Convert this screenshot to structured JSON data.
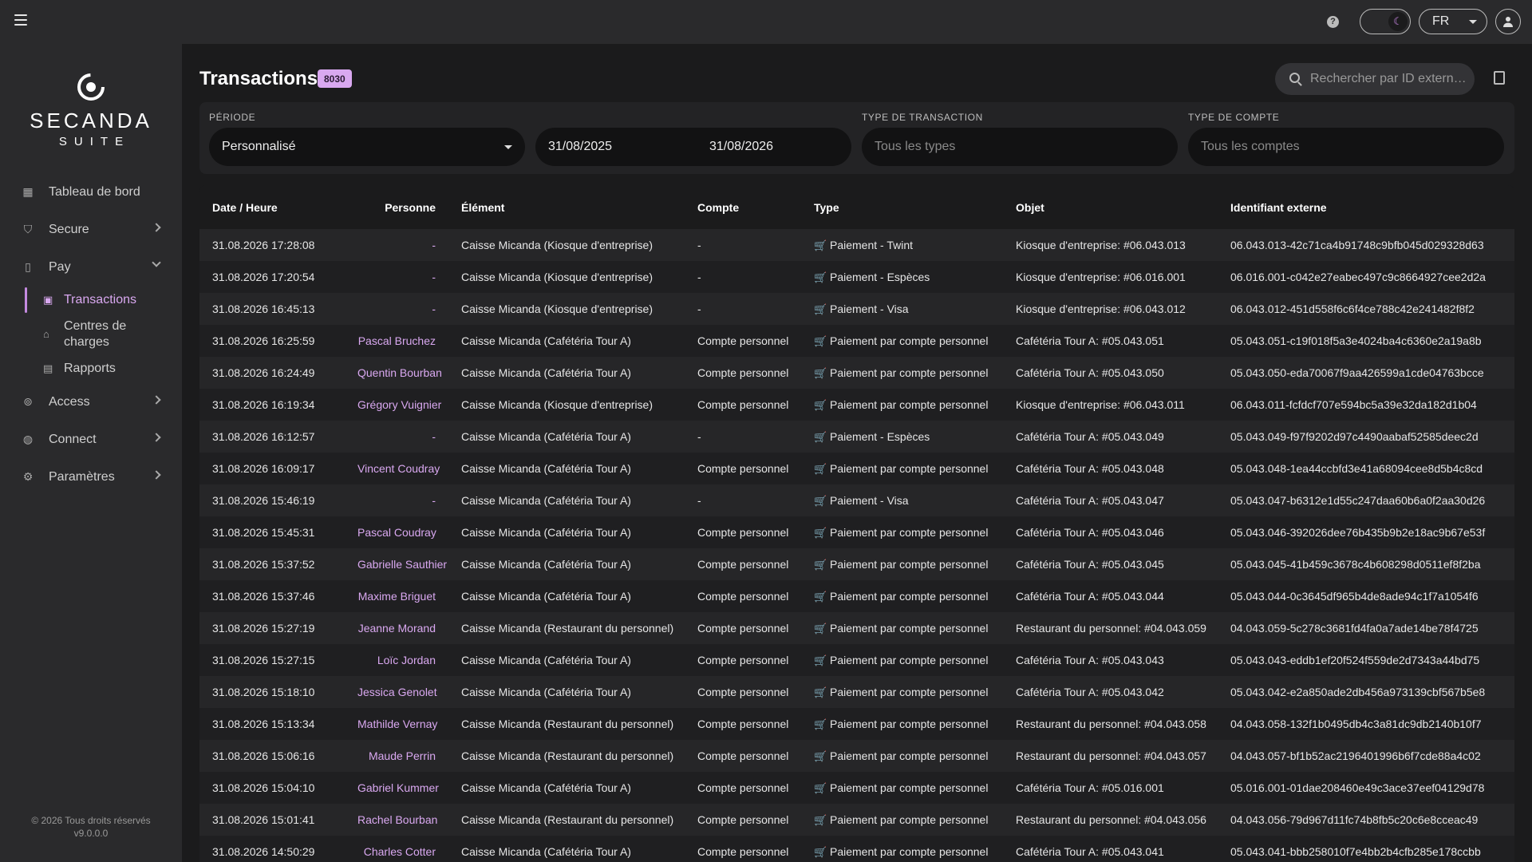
{
  "topbar": {
    "language": "FR"
  },
  "sidebar": {
    "logo_name": "SECANDA",
    "logo_sub": "SUITE",
    "items": [
      {
        "label": "Tableau de bord",
        "icon": "grid-icon"
      },
      {
        "label": "Secure",
        "icon": "shield-icon"
      },
      {
        "label": "Pay",
        "icon": "phone-icon"
      },
      {
        "label": "Access",
        "icon": "lock-icon"
      },
      {
        "label": "Connect",
        "icon": "globe-icon"
      },
      {
        "label": "Paramètres",
        "icon": "gear-icon"
      }
    ],
    "pay_sub": [
      {
        "label": "Transactions",
        "icon": "money-icon"
      },
      {
        "label": "Centres de charges",
        "icon": "bank-icon"
      },
      {
        "label": "Rapports",
        "icon": "document-icon"
      }
    ],
    "footer_copyright": "© 2026 Tous droits réservés",
    "footer_version": "v9.0.0.0"
  },
  "page": {
    "title": "Transactions",
    "count": "8030",
    "search_placeholder": "Rechercher par ID extern…"
  },
  "filters": {
    "periode_label": "PÉRIODE",
    "periode_value": "Personnalisé",
    "date_from": "31/08/2025",
    "date_to": "31/08/2026",
    "type_label": "TYPE DE TRANSACTION",
    "type_placeholder": "Tous les types",
    "compte_label": "TYPE DE COMPTE",
    "compte_placeholder": "Tous les comptes"
  },
  "table": {
    "headers": [
      "Date / Heure",
      "Personne",
      "Élément",
      "Compte",
      "Type",
      "Objet",
      "Identifiant externe"
    ],
    "rows": [
      [
        "31.08.2026 17:28:08",
        "-",
        "Caisse Micanda (Kiosque d'entreprise)",
        "-",
        "Paiement - Twint",
        "Kiosque d'entreprise: #06.043.013",
        "06.043.013-42c71ca4b91748c9bfb045d029328d63"
      ],
      [
        "31.08.2026 17:20:54",
        "-",
        "Caisse Micanda (Kiosque d'entreprise)",
        "-",
        "Paiement - Espèces",
        "Kiosque d'entreprise: #06.016.001",
        "06.016.001-c042e27eabec497c9c8664927cee2d2a"
      ],
      [
        "31.08.2026 16:45:13",
        "-",
        "Caisse Micanda (Kiosque d'entreprise)",
        "-",
        "Paiement - Visa",
        "Kiosque d'entreprise: #06.043.012",
        "06.043.012-451d558f6c6f4ce788c42e241482f8f2"
      ],
      [
        "31.08.2026 16:25:59",
        "Pascal Bruchez",
        "Caisse Micanda (Cafétéria Tour A)",
        "Compte personnel",
        "Paiement par compte personnel",
        "Cafétéria Tour A: #05.043.051",
        "05.043.051-c19f018f5a3e4024ba4c6360e2a19a8b"
      ],
      [
        "31.08.2026 16:24:49",
        "Quentin Bourban",
        "Caisse Micanda (Cafétéria Tour A)",
        "Compte personnel",
        "Paiement par compte personnel",
        "Cafétéria Tour A: #05.043.050",
        "05.043.050-eda70067f9aa426599a1cde04763bcce"
      ],
      [
        "31.08.2026 16:19:34",
        "Grégory Vuignier",
        "Caisse Micanda (Kiosque d'entreprise)",
        "Compte personnel",
        "Paiement par compte personnel",
        "Kiosque d'entreprise: #06.043.011",
        "06.043.011-fcfdcf707e594bc5a39e32da182d1b04"
      ],
      [
        "31.08.2026 16:12:57",
        "-",
        "Caisse Micanda (Cafétéria Tour A)",
        "-",
        "Paiement - Espèces",
        "Cafétéria Tour A: #05.043.049",
        "05.043.049-f97f9202d97c4490aabaf52585deec2d"
      ],
      [
        "31.08.2026 16:09:17",
        "Vincent Coudray",
        "Caisse Micanda (Cafétéria Tour A)",
        "Compte personnel",
        "Paiement par compte personnel",
        "Cafétéria Tour A: #05.043.048",
        "05.043.048-1ea44ccbfd3e41a68094cee8d5b4c8cd"
      ],
      [
        "31.08.2026 15:46:19",
        "-",
        "Caisse Micanda (Cafétéria Tour A)",
        "-",
        "Paiement - Visa",
        "Cafétéria Tour A: #05.043.047",
        "05.043.047-b6312e1d55c247daa60b6a0f2aa30d26"
      ],
      [
        "31.08.2026 15:45:31",
        "Pascal Coudray",
        "Caisse Micanda (Cafétéria Tour A)",
        "Compte personnel",
        "Paiement par compte personnel",
        "Cafétéria Tour A: #05.043.046",
        "05.043.046-392026dee76b435b9b2e18ac9b67e53f"
      ],
      [
        "31.08.2026 15:37:52",
        "Gabrielle Sauthier",
        "Caisse Micanda (Cafétéria Tour A)",
        "Compte personnel",
        "Paiement par compte personnel",
        "Cafétéria Tour A: #05.043.045",
        "05.043.045-41b459c3678c4b608298d0511ef8f2ba"
      ],
      [
        "31.08.2026 15:37:46",
        "Maxime Briguet",
        "Caisse Micanda (Cafétéria Tour A)",
        "Compte personnel",
        "Paiement par compte personnel",
        "Cafétéria Tour A: #05.043.044",
        "05.043.044-0c3645df965b4de8ade94c1f7a1054f6"
      ],
      [
        "31.08.2026 15:27:19",
        "Jeanne Morand",
        "Caisse Micanda (Restaurant du personnel)",
        "Compte personnel",
        "Paiement par compte personnel",
        "Restaurant du personnel: #04.043.059",
        "04.043.059-5c278c3681fd4fa0a7ade14be78f4725"
      ],
      [
        "31.08.2026 15:27:15",
        "Loïc Jordan",
        "Caisse Micanda (Cafétéria Tour A)",
        "Compte personnel",
        "Paiement par compte personnel",
        "Cafétéria Tour A: #05.043.043",
        "05.043.043-eddb1ef20f524f559de2d7343a44bd75"
      ],
      [
        "31.08.2026 15:18:10",
        "Jessica Genolet",
        "Caisse Micanda (Cafétéria Tour A)",
        "Compte personnel",
        "Paiement par compte personnel",
        "Cafétéria Tour A: #05.043.042",
        "05.043.042-e2a850ade2db456a973139cbf567b5e8"
      ],
      [
        "31.08.2026 15:13:34",
        "Mathilde Vernay",
        "Caisse Micanda (Restaurant du personnel)",
        "Compte personnel",
        "Paiement par compte personnel",
        "Restaurant du personnel: #04.043.058",
        "04.043.058-132f1b0495db4c3a81dc9db2140b10f7"
      ],
      [
        "31.08.2026 15:06:16",
        "Maude Perrin",
        "Caisse Micanda (Restaurant du personnel)",
        "Compte personnel",
        "Paiement par compte personnel",
        "Restaurant du personnel: #04.043.057",
        "04.043.057-bf1b52ac2196401996b6f7cde88a4c02"
      ],
      [
        "31.08.2026 15:04:10",
        "Gabriel Kummer",
        "Caisse Micanda (Cafétéria Tour A)",
        "Compte personnel",
        "Paiement par compte personnel",
        "Cafétéria Tour A: #05.016.001",
        "05.016.001-01dae208460e49c3ace37eef04129d78"
      ],
      [
        "31.08.2026 15:01:41",
        "Rachel Bourban",
        "Caisse Micanda (Restaurant du personnel)",
        "Compte personnel",
        "Paiement par compte personnel",
        "Restaurant du personnel: #04.043.056",
        "04.043.056-79d967d11fc74b8fb5c20c6e8cceac49"
      ],
      [
        "31.08.2026 14:50:29",
        "Charles Cotter",
        "Caisse Micanda (Cafétéria Tour A)",
        "Compte personnel",
        "Paiement par compte personnel",
        "Cafétéria Tour A: #05.043.041",
        "05.043.041-bbb258010f7e4bb2b4cfb285e178ccbb"
      ]
    ]
  }
}
